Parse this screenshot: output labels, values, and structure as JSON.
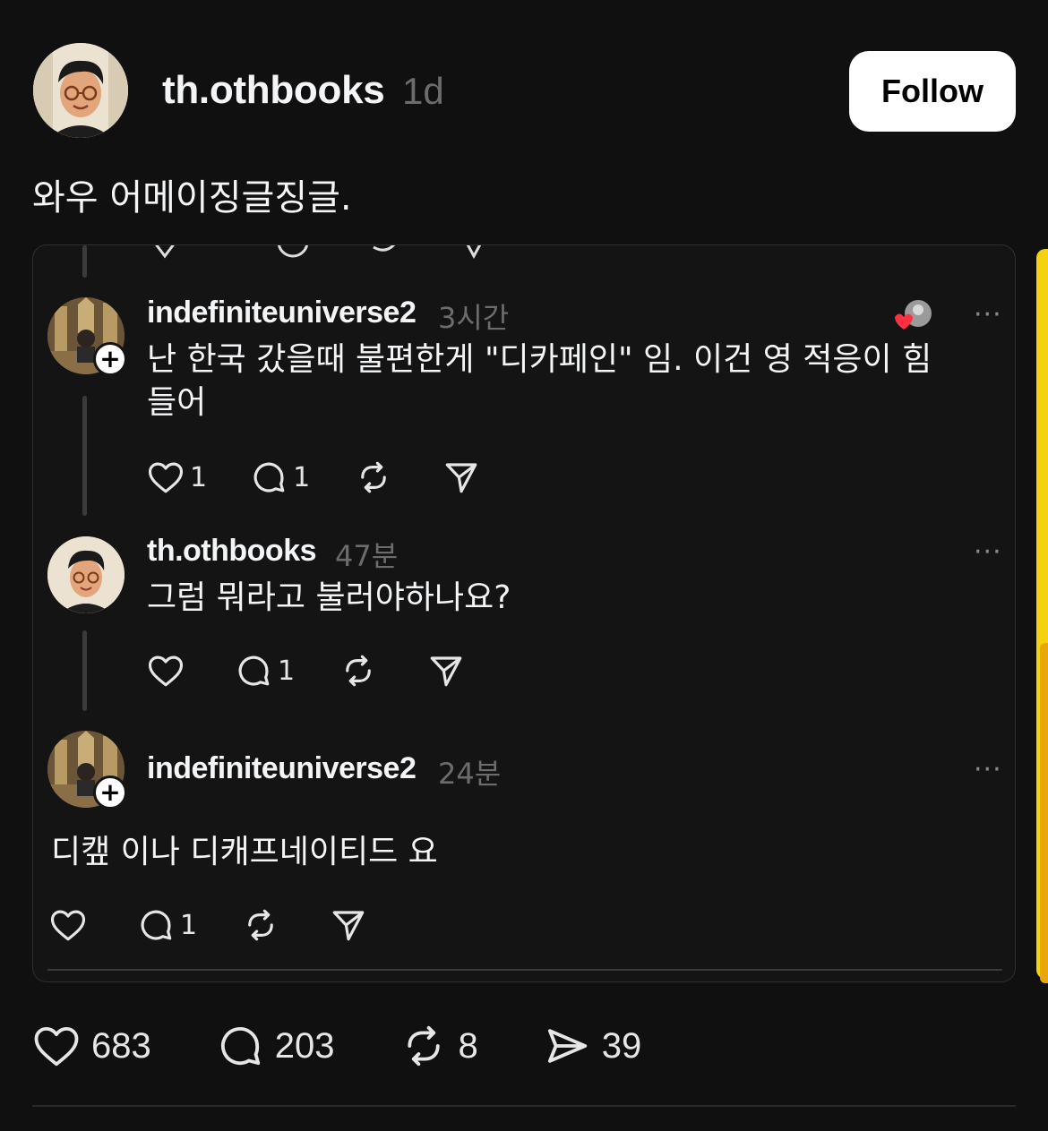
{
  "post": {
    "author": "th.othbooks",
    "time": "1d",
    "follow_label": "Follow",
    "caption": "와우 어메이징글징글."
  },
  "screenshot": {
    "comments": [
      {
        "user": "indefiniteuniverse2",
        "time": "3시간",
        "text_line1": "난 한국 갔을때 불편한게 \"디카페인\" 임. 이건 영 적응이 힘",
        "text_line2": "들어",
        "likes": "1",
        "replies": "1"
      },
      {
        "user": "th.othbooks",
        "time": "47분",
        "text": "그럼 뭐라고 불러야하나요?",
        "likes": "",
        "replies": "1"
      },
      {
        "user": "indefiniteuniverse2",
        "time": "24분",
        "text": "디캪 이나 디캐프네이티드 요",
        "likes": "",
        "replies": "1"
      }
    ],
    "more_label": "···",
    "plus_label": "+"
  },
  "stats": {
    "likes": "683",
    "replies": "203",
    "reposts": "8",
    "shares": "39"
  },
  "colors": {
    "background": "#101010",
    "accent_heart": "#ff3040",
    "side_strip": "#f4d20f"
  }
}
